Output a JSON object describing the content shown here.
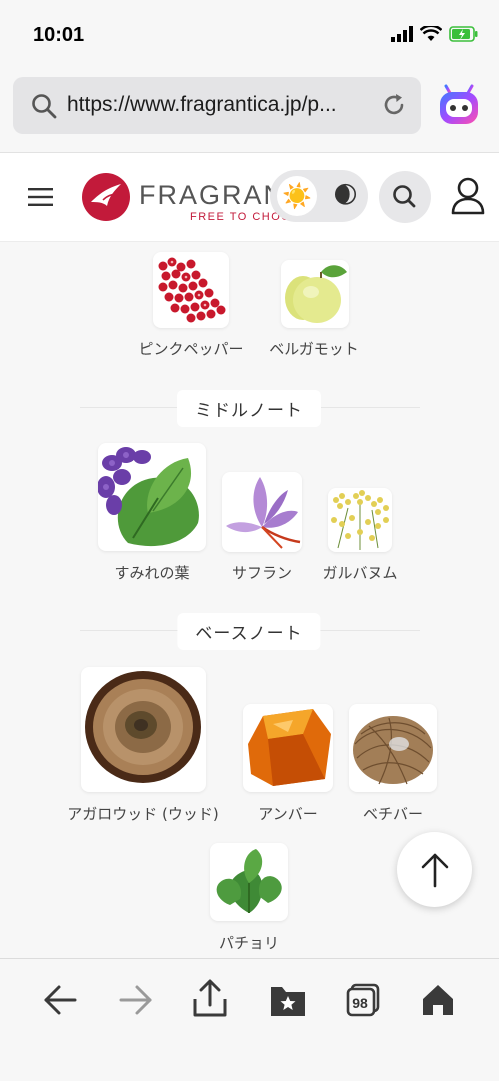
{
  "status": {
    "time": "10:01"
  },
  "browser": {
    "url": "https://www.fragrantica.jp/p..."
  },
  "site": {
    "logo_text": "FRAGRAN",
    "logo_tag": "FREE TO CHOOSE"
  },
  "notes": {
    "top": [
      {
        "label": "ピンクペッパー",
        "icon": "pink-pepper"
      },
      {
        "label": "ベルガモット",
        "icon": "bergamot"
      }
    ],
    "middle_title": "ミドルノート",
    "middle": [
      {
        "label": "すみれの葉",
        "icon": "violet-leaf"
      },
      {
        "label": "サフラン",
        "icon": "saffron"
      },
      {
        "label": "ガルバヌム",
        "icon": "galbanum"
      }
    ],
    "base_title": "ベースノート",
    "base": [
      {
        "label": "アガロウッド (ウッド)",
        "icon": "agarwood"
      },
      {
        "label": "アンバー",
        "icon": "amber"
      },
      {
        "label": "ベチバー",
        "icon": "vetiver"
      },
      {
        "label": "パチョリ",
        "icon": "patchouli"
      }
    ]
  },
  "toolbar": {
    "tab_count": "98"
  },
  "colors": {
    "brand": "#c21a3a",
    "background": "#f7f7f7"
  }
}
